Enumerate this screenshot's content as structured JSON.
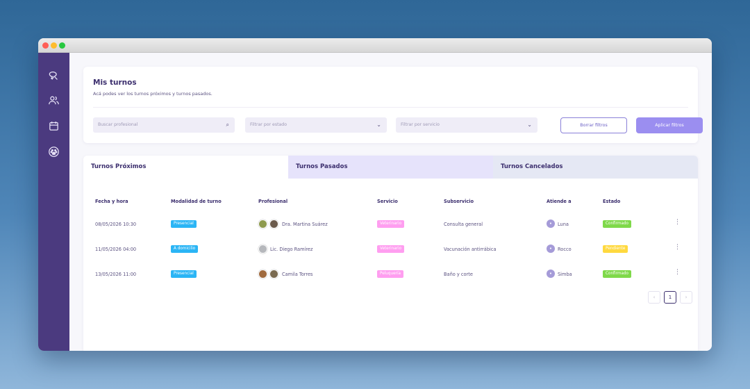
{
  "header": {
    "title": "Mis turnos",
    "subtitle": "Acá podes ver los turnos próximos y turnos pasados."
  },
  "filters": {
    "search_placeholder": "Buscar profesional",
    "status_placeholder": "Filtrar por estado",
    "service_placeholder": "Filtrar por servicio",
    "clear_label": "Borrar filtros",
    "apply_label": "Aplicar filtros"
  },
  "tabs": [
    {
      "label": "Turnos Próximos"
    },
    {
      "label": "Turnos Pasados"
    },
    {
      "label": "Turnos Cancelados"
    }
  ],
  "table": {
    "headers": [
      "Fecha y hora",
      "Modalidad de turno",
      "Profesional",
      "Servicio",
      "Subservicio",
      "Atiende a",
      "Estado"
    ],
    "rows": [
      {
        "fecha": "08/05/2026 10:30",
        "modalidad": "Presencial",
        "profesional": "Dra. Martina Suárez",
        "servicio": "Veterinario",
        "subservicio": "Consulta general",
        "atiende": "Luna",
        "estado": "Confirmado"
      },
      {
        "fecha": "11/05/2026 04:00",
        "modalidad": "A domicilio",
        "profesional": "Lic. Diego Ramírez",
        "servicio": "Veterinario",
        "subservicio": "Vacunación antirrábica",
        "atiende": "Rocco",
        "estado": "Pendiente"
      },
      {
        "fecha": "13/05/2026 11:00",
        "modalidad": "Presencial",
        "profesional": "Camila Torres",
        "servicio": "Peluquería",
        "subservicio": "Baño y corte",
        "atiende": "Simba",
        "estado": "Confirmado"
      }
    ]
  },
  "pagination": {
    "current": "1",
    "prev": "‹",
    "next": "›"
  },
  "colors": {
    "sidebar": "#4b3a7f",
    "accent": "#9b8ef0",
    "presencial": "#2bb5f5",
    "servicio": "#ff9ef0",
    "confirmado": "#7fd94a",
    "pendiente": "#ffd93f"
  }
}
